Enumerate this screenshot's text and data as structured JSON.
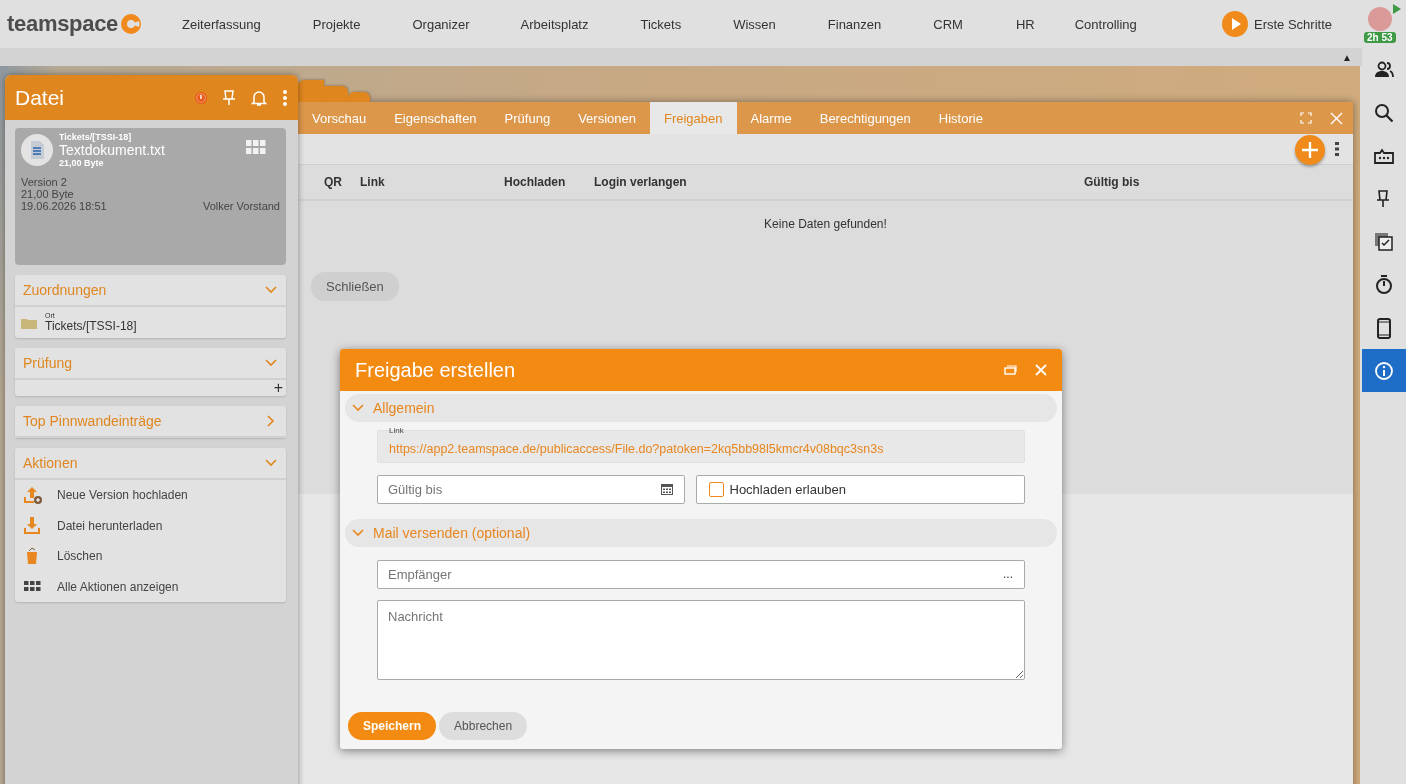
{
  "top_nav": {
    "logo": "teamspace",
    "items": [
      "Zeiterfassung",
      "Projekte",
      "Organizer",
      "Arbeitsplatz",
      "Tickets",
      "Wissen",
      "Finanzen",
      "CRM",
      "HR",
      "Controlling"
    ],
    "help": "Erste Schritte",
    "timer": "2h 53"
  },
  "strip": {
    "collapse_toggle": "▲"
  },
  "right_sidebar": {
    "items": [
      {
        "kind": "people",
        "selected": false
      },
      {
        "kind": "search",
        "selected": false
      },
      {
        "kind": "ticket",
        "selected": false
      },
      {
        "kind": "pin",
        "selected": false
      },
      {
        "kind": "tasks",
        "selected": false
      },
      {
        "kind": "stopwatch",
        "selected": false
      },
      {
        "kind": "phone",
        "selected": false
      },
      {
        "kind": "info",
        "selected": true
      }
    ]
  },
  "file_panel": {
    "title": "Datei",
    "file": {
      "path": "Tickets/[TSSI-18]",
      "name": "Textdokument.txt",
      "size": "21,00 Byte",
      "version": "Version 2",
      "size_detail": "21,00 Byte",
      "date": "19.06.2026 18:51",
      "author": "Volker Vorstand"
    },
    "sections": [
      {
        "title": "Zuordnungen",
        "expanded": true,
        "kind": "assignment",
        "label": "Ort",
        "value": "Tickets/[TSSI-18]"
      },
      {
        "title": "Prüfung",
        "expanded": true,
        "kind": "add",
        "add": "+"
      },
      {
        "title": "Top Pinnwandeinträge",
        "expanded": false,
        "kind": "empty"
      },
      {
        "title": "Aktionen",
        "expanded": true,
        "kind": "actions",
        "actions": [
          {
            "kind": "upload",
            "label": "Neue Version hochladen"
          },
          {
            "kind": "download",
            "label": "Datei herunterladen"
          },
          {
            "kind": "delete",
            "label": "Löschen"
          },
          {
            "kind": "all",
            "label": "Alle Aktionen anzeigen"
          }
        ]
      }
    ]
  },
  "main_window": {
    "tabs": [
      {
        "label": "Vorschau",
        "selected": false
      },
      {
        "label": "Eigenschaften",
        "selected": false
      },
      {
        "label": "Prüfung",
        "selected": false
      },
      {
        "label": "Versionen",
        "selected": false
      },
      {
        "label": "Freigaben",
        "selected": true
      },
      {
        "label": "Alarme",
        "selected": false
      },
      {
        "label": "Berechtigungen",
        "selected": false
      },
      {
        "label": "Historie",
        "selected": false
      }
    ],
    "columns": [
      "QR",
      "Link",
      "Hochladen",
      "Login verlangen",
      "Gültig bis"
    ],
    "empty_message": "Keine Daten gefunden!",
    "close_button": "Schließen"
  },
  "dialog": {
    "title": "Freigabe erstellen",
    "sections": [
      {
        "title": "Allgemein",
        "expanded": true
      },
      {
        "title": "Mail versenden (optional)",
        "expanded": true
      }
    ],
    "link": {
      "label": "Link",
      "value": "https://app2.teamspace.de/publicaccess/File.do?patoken=2kq5bb98l5kmcr4v08bqc3sn3s"
    },
    "valid_until": {
      "placeholder": "Gültig bis"
    },
    "allow_upload": {
      "label": "Hochladen erlauben",
      "checked": false
    },
    "recipient": {
      "placeholder": "Empfänger",
      "button": "..."
    },
    "message": {
      "placeholder": "Nachricht"
    },
    "buttons": [
      {
        "label": "Speichern",
        "kind": "primary"
      },
      {
        "label": "Abbrechen",
        "kind": "secondary"
      }
    ]
  }
}
